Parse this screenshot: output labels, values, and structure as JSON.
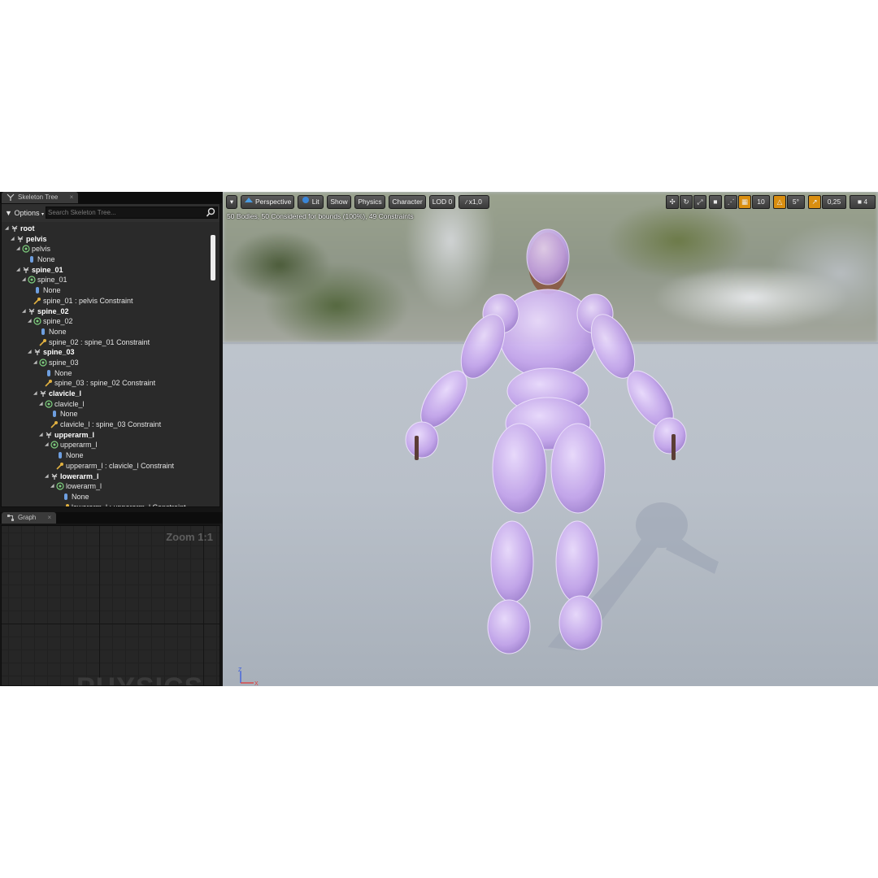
{
  "skeleton_tree": {
    "tab_label": "Skeleton Tree",
    "options_label": "Options",
    "search_placeholder": "Search Skeleton Tree...",
    "rows": [
      {
        "label": "root",
        "type": "bone",
        "depth": 0
      },
      {
        "label": "pelvis",
        "type": "bone",
        "depth": 1
      },
      {
        "label": "pelvis",
        "type": "body",
        "depth": 2
      },
      {
        "label": "None",
        "type": "shape",
        "depth": 3
      },
      {
        "label": "spine_01",
        "type": "bone",
        "depth": 2
      },
      {
        "label": "spine_01",
        "type": "body",
        "depth": 3
      },
      {
        "label": "None",
        "type": "shape",
        "depth": 4
      },
      {
        "label": "spine_01 : pelvis Constraint",
        "type": "constraint",
        "depth": 4
      },
      {
        "label": "spine_02",
        "type": "bone",
        "depth": 3
      },
      {
        "label": "spine_02",
        "type": "body",
        "depth": 4
      },
      {
        "label": "None",
        "type": "shape",
        "depth": 5
      },
      {
        "label": "spine_02 : spine_01 Constraint",
        "type": "constraint",
        "depth": 5
      },
      {
        "label": "spine_03",
        "type": "bone",
        "depth": 4
      },
      {
        "label": "spine_03",
        "type": "body",
        "depth": 5
      },
      {
        "label": "None",
        "type": "shape",
        "depth": 6
      },
      {
        "label": "spine_03 : spine_02 Constraint",
        "type": "constraint",
        "depth": 6
      },
      {
        "label": "clavicle_l",
        "type": "bone",
        "depth": 5
      },
      {
        "label": "clavicle_l",
        "type": "body",
        "depth": 6
      },
      {
        "label": "None",
        "type": "shape",
        "depth": 7
      },
      {
        "label": "clavicle_l : spine_03 Constraint",
        "type": "constraint",
        "depth": 7
      },
      {
        "label": "upperarm_l",
        "type": "bone",
        "depth": 6
      },
      {
        "label": "upperarm_l",
        "type": "body",
        "depth": 7
      },
      {
        "label": "None",
        "type": "shape",
        "depth": 8
      },
      {
        "label": "upperarm_l : clavicle_l Constraint",
        "type": "constraint",
        "depth": 8
      },
      {
        "label": "lowerarm_l",
        "type": "bone",
        "depth": 7
      },
      {
        "label": "lowerarm_l",
        "type": "body",
        "depth": 8
      },
      {
        "label": "None",
        "type": "shape",
        "depth": 9
      },
      {
        "label": "lowerarm_l : upperarm_l Constraint",
        "type": "constraint",
        "depth": 9
      }
    ]
  },
  "graph": {
    "tab_label": "Graph",
    "zoom_label": "Zoom 1:1",
    "watermark": "PHYSICS"
  },
  "viewport": {
    "toolbar": {
      "perspective": "Perspective",
      "lit": "Lit",
      "show": "Show",
      "physics": "Physics",
      "character": "Character",
      "lod": "LOD 0",
      "speed": "x1,0"
    },
    "stats": "50 Bodies, 50 Considered for bounds (100%), 49 Constraints",
    "right_toolbar": {
      "grid_snap": "10",
      "rotation_snap": "5°",
      "scale_snap": "0,25",
      "camera_speed": "4"
    },
    "axis": {
      "z": "Z",
      "x": "X"
    }
  },
  "colors": {
    "ragdoll": "#c8a8f0",
    "accent": "#d98e10",
    "panel": "#2a2a2a"
  }
}
